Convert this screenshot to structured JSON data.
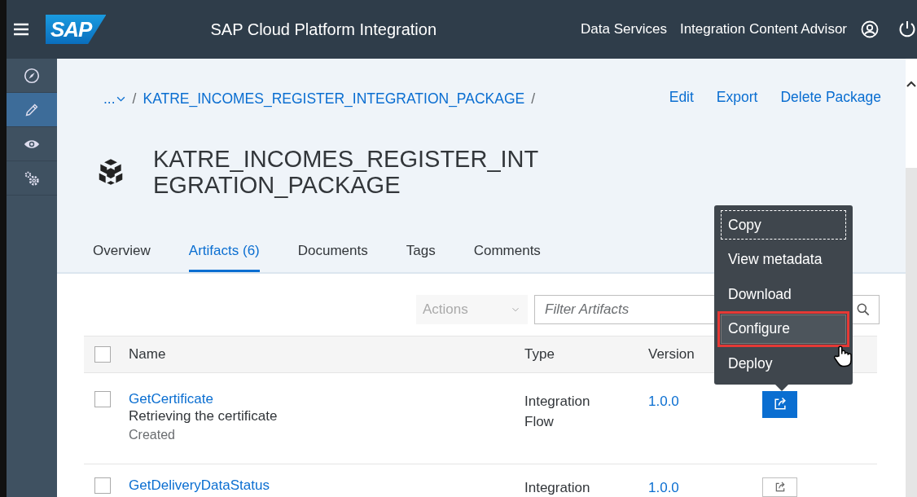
{
  "header": {
    "logo": "SAP",
    "title": "SAP Cloud Platform Integration",
    "links": [
      "Data Services",
      "Integration Content Advisor"
    ]
  },
  "sidebar": {
    "items": [
      {
        "kind": "compass",
        "selected": false
      },
      {
        "kind": "pencil",
        "selected": true
      },
      {
        "kind": "eye",
        "selected": false
      },
      {
        "kind": "gears",
        "selected": false
      }
    ]
  },
  "breadcrumb": {
    "overflow": "...",
    "separator": "/",
    "package": "KATRE_INCOMES_REGISTER_INTEGRATION_PACKAGE"
  },
  "page_actions": [
    "Edit",
    "Export",
    "Delete Package"
  ],
  "title_lines": [
    "KATRE_INCOMES_REGISTER_INT",
    "EGRATION_PACKAGE"
  ],
  "tabs": [
    {
      "label": "Overview",
      "selected": false
    },
    {
      "label": "Artifacts (6)",
      "selected": true
    },
    {
      "label": "Documents",
      "selected": false
    },
    {
      "label": "Tags",
      "selected": false
    },
    {
      "label": "Comments",
      "selected": false
    }
  ],
  "toolbar": {
    "actions": {
      "label": "Actions",
      "disabled": true
    },
    "filter": {
      "placeholder": "Filter Artifacts"
    }
  },
  "table": {
    "select_all_checked": false,
    "columns": [
      "Name",
      "Type",
      "Version"
    ],
    "rows": [
      {
        "name": "GetCertificate",
        "description": "Retrieving the certificate",
        "status": "Created",
        "checked": false,
        "type": "Integration Flow",
        "version": "1.0.0",
        "action_active": true
      },
      {
        "name": "GetDeliveryDataStatus",
        "checked": false,
        "type": "Integration",
        "version": "1.0.0",
        "action_active": false
      }
    ]
  },
  "context_menu": {
    "items": [
      {
        "label": "Copy",
        "focused": true,
        "selected": false
      },
      {
        "label": "View metadata",
        "focused": false,
        "selected": false
      },
      {
        "label": "Download",
        "focused": false,
        "selected": false
      },
      {
        "label": "Configure",
        "focused": false,
        "selected": true
      },
      {
        "label": "Deploy",
        "focused": false,
        "selected": false
      }
    ]
  }
}
